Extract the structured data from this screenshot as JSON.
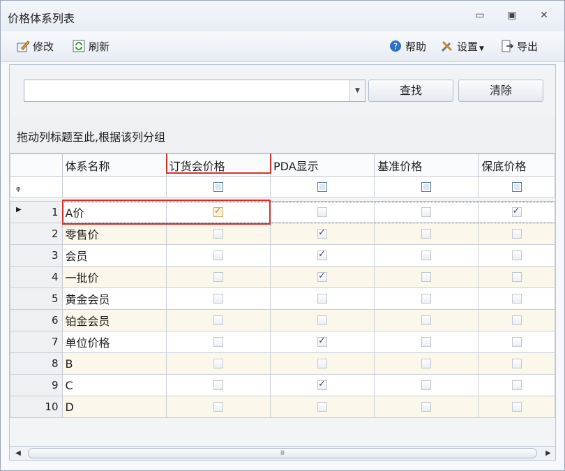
{
  "window": {
    "title": "价格体系列表",
    "minimize_icon": "minimize-icon",
    "maximize_icon": "maximize-icon",
    "close_icon": "close-icon"
  },
  "toolbar": {
    "modify_label": "修改",
    "refresh_label": "刷新",
    "help_label": "帮助",
    "settings_label": "设置",
    "export_label": "导出"
  },
  "search": {
    "value": "",
    "find_label": "查找",
    "clear_label": "清除"
  },
  "group_panel": {
    "hint": "拖动列标题至此,根据该列分组"
  },
  "columns": [
    "体系名称",
    "订货会价格",
    "PDA显示",
    "基准价格",
    "保底价格"
  ],
  "rows": [
    {
      "n": "1",
      "name": "A价",
      "order": true,
      "pda": false,
      "base": false,
      "floor": true
    },
    {
      "n": "2",
      "name": "零售价",
      "order": false,
      "pda": true,
      "base": false,
      "floor": false
    },
    {
      "n": "3",
      "name": "会员",
      "order": false,
      "pda": true,
      "base": false,
      "floor": false
    },
    {
      "n": "4",
      "name": "一批价",
      "order": false,
      "pda": true,
      "base": false,
      "floor": false
    },
    {
      "n": "5",
      "name": "黄金会员",
      "order": false,
      "pda": false,
      "base": false,
      "floor": false
    },
    {
      "n": "6",
      "name": "铂金会员",
      "order": false,
      "pda": false,
      "base": false,
      "floor": false
    },
    {
      "n": "7",
      "name": "单位价格",
      "order": false,
      "pda": true,
      "base": false,
      "floor": false
    },
    {
      "n": "8",
      "name": "B",
      "order": false,
      "pda": false,
      "base": false,
      "floor": false
    },
    {
      "n": "9",
      "name": "C",
      "order": false,
      "pda": true,
      "base": false,
      "floor": false
    },
    {
      "n": "10",
      "name": "D",
      "order": false,
      "pda": false,
      "base": false,
      "floor": false
    }
  ],
  "colors": {
    "highlight": "#d9302c",
    "alt_row": "#fbf7ea"
  }
}
